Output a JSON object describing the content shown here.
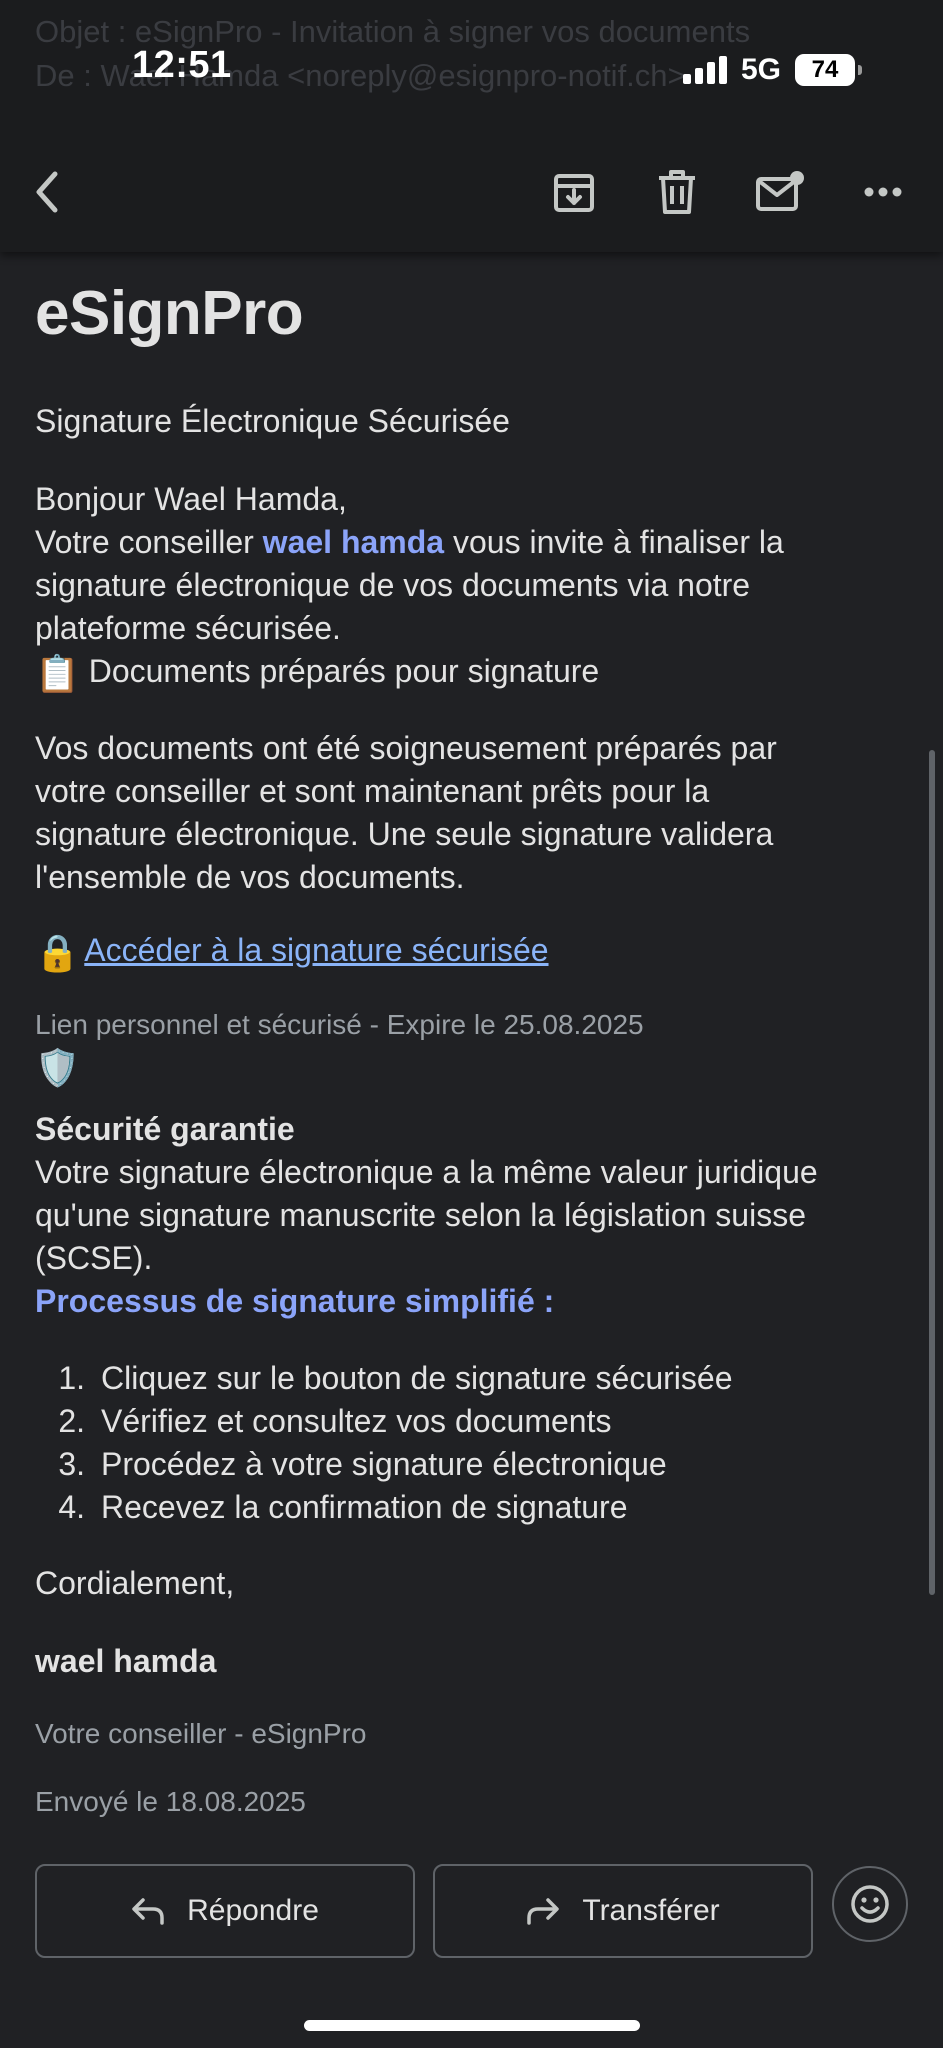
{
  "status_bar": {
    "time": "12:51",
    "network": "5G",
    "battery": "74"
  },
  "background_preview": {
    "line1": "Objet : eSignPro - Invitation à signer vos documents",
    "line2": "De : Wael Hamda <noreply@esignpro-notif.ch>"
  },
  "toolbar": {
    "back_icon": "chevron-left-icon",
    "archive_icon": "archive-icon",
    "delete_icon": "trash-icon",
    "mark_unread_icon": "mail-unread-icon",
    "more_icon": "more-horizontal-icon"
  },
  "email": {
    "brand": "eSignPro",
    "tagline": "Signature Électronique Sécurisée",
    "greeting": "Bonjour Wael Hamda,",
    "intro_pre": "Votre conseiller ",
    "intro_name": "wael hamda",
    "intro_post": " vous invite à finaliser la",
    "intro_line2": "signature électronique de vos documents via notre",
    "intro_line3": "plateforme sécurisée.",
    "docs_icon": "📋",
    "docs_heading": "Documents préparés pour signature",
    "para_line1": "Vos documents ont été soigneusement préparés par",
    "para_line2": "votre conseiller et sont maintenant prêts pour la",
    "para_line3": "signature électronique. Une seule signature validera",
    "para_line4": "l'ensemble de vos documents.",
    "link_icon": "🔒",
    "link_text": "Accéder à la signature sécurisée",
    "link_note": "Lien personnel et sécurisé - Expire le 25.08.2025",
    "security_icon": "🛡️",
    "security_heading": "Sécurité garantie",
    "security_line1": "Votre signature électronique a la même valeur juridique",
    "security_line2": "qu'une signature manuscrite selon la législation suisse",
    "security_line3": "(SCSE).",
    "process_heading": "Processus de signature simplifié :",
    "steps": [
      {
        "num": "1.",
        "text": "Cliquez sur le bouton de signature sécurisée"
      },
      {
        "num": "2.",
        "text": "Vérifiez et consultez vos documents"
      },
      {
        "num": "3.",
        "text": "Procédez à votre signature électronique"
      },
      {
        "num": "4.",
        "text": "Recevez la confirmation de signature"
      }
    ],
    "closing": "Cordialement,",
    "signature_name": "wael hamda",
    "signature_role": "Votre conseiller - eSignPro",
    "sent_date": "Envoyé le 18.08.2025"
  },
  "actions": {
    "reply_label": "Répondre",
    "forward_label": "Transférer",
    "emoji_icon": "smiley-icon"
  },
  "colors": {
    "background": "#202124",
    "accent": "#8ba4f9",
    "link": "#8ab4f8",
    "muted": "#9aa0a6"
  }
}
